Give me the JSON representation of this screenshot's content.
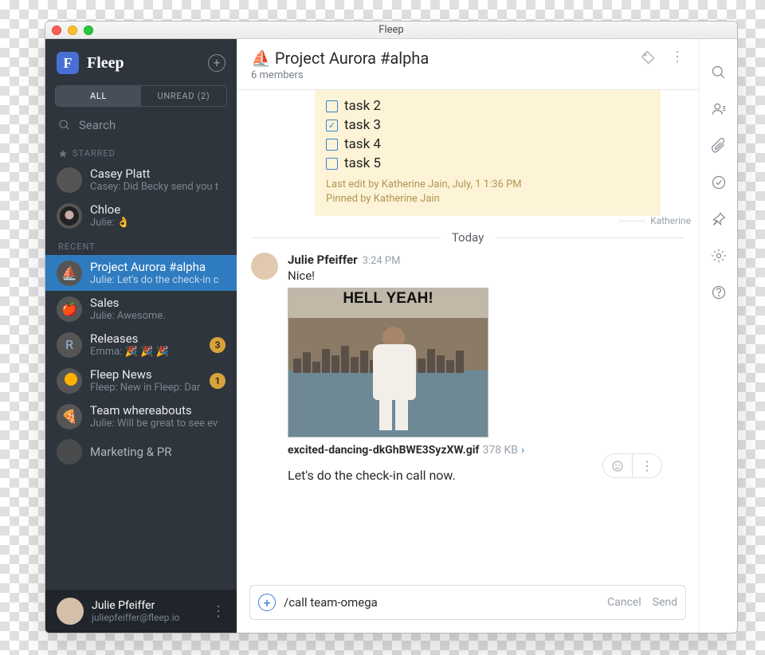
{
  "window": {
    "title": "Fleep"
  },
  "sidebar": {
    "brand": "Fleep",
    "tabs": {
      "all": "ALL",
      "unread": "UNREAD (2)"
    },
    "search_placeholder": "Search",
    "section_starred": "STARRED",
    "section_recent": "RECENT",
    "starred": [
      {
        "name": "Casey Platt",
        "preview": "Casey: Did Becky send you t"
      },
      {
        "name": "Chloe",
        "preview": "Julie: 👌"
      }
    ],
    "recent": [
      {
        "name": "Project Aurora #alpha",
        "preview": "Julie: Let's do the check-in c",
        "selected": true
      },
      {
        "name": "Sales",
        "preview": "Julie: Awesome.",
        "emoji": "🍎"
      },
      {
        "name": "Releases",
        "preview": "Emma: 🎉 🎉 🎉",
        "badge": "3",
        "letter": "R"
      },
      {
        "name": "Fleep News",
        "preview": "Fleep: New in Fleep: Dar",
        "badge": "1"
      },
      {
        "name": "Team whereabouts",
        "preview": "Julie: Will be great to see ev",
        "emoji": "🍕"
      },
      {
        "name": "Marketing & PR",
        "preview": ""
      }
    ],
    "footer": {
      "name": "Julie Pfeiffer",
      "email": "juliepfeiffer@fleep.io"
    }
  },
  "chat": {
    "title_emoji": "⛵",
    "title": "Project Aurora #alpha",
    "subtitle": "6 members",
    "pinned": {
      "tasks": [
        {
          "label": "task 2",
          "done": false
        },
        {
          "label": "task 3",
          "done": true
        },
        {
          "label": "task 4",
          "done": false
        },
        {
          "label": "task 5",
          "done": false
        }
      ],
      "meta1": "Last edit by Katherine Jain, July, 1 1:36 PM",
      "meta2": "Pinned by Katherine Jain"
    },
    "seen_by": "Katherine",
    "divider": "Today",
    "message": {
      "author": "Julie Pfeiffer",
      "time": "3:24 PM",
      "text": "Nice!",
      "gif_caption": "HELL YEAH!",
      "file_name": "excited-dancing-dkGhBWE3SyzXW.gif",
      "file_size": "378 KB",
      "text2": "Let's do the check-in call now."
    },
    "composer": {
      "value": "/call team-omega",
      "cancel": "Cancel",
      "send": "Send"
    }
  }
}
